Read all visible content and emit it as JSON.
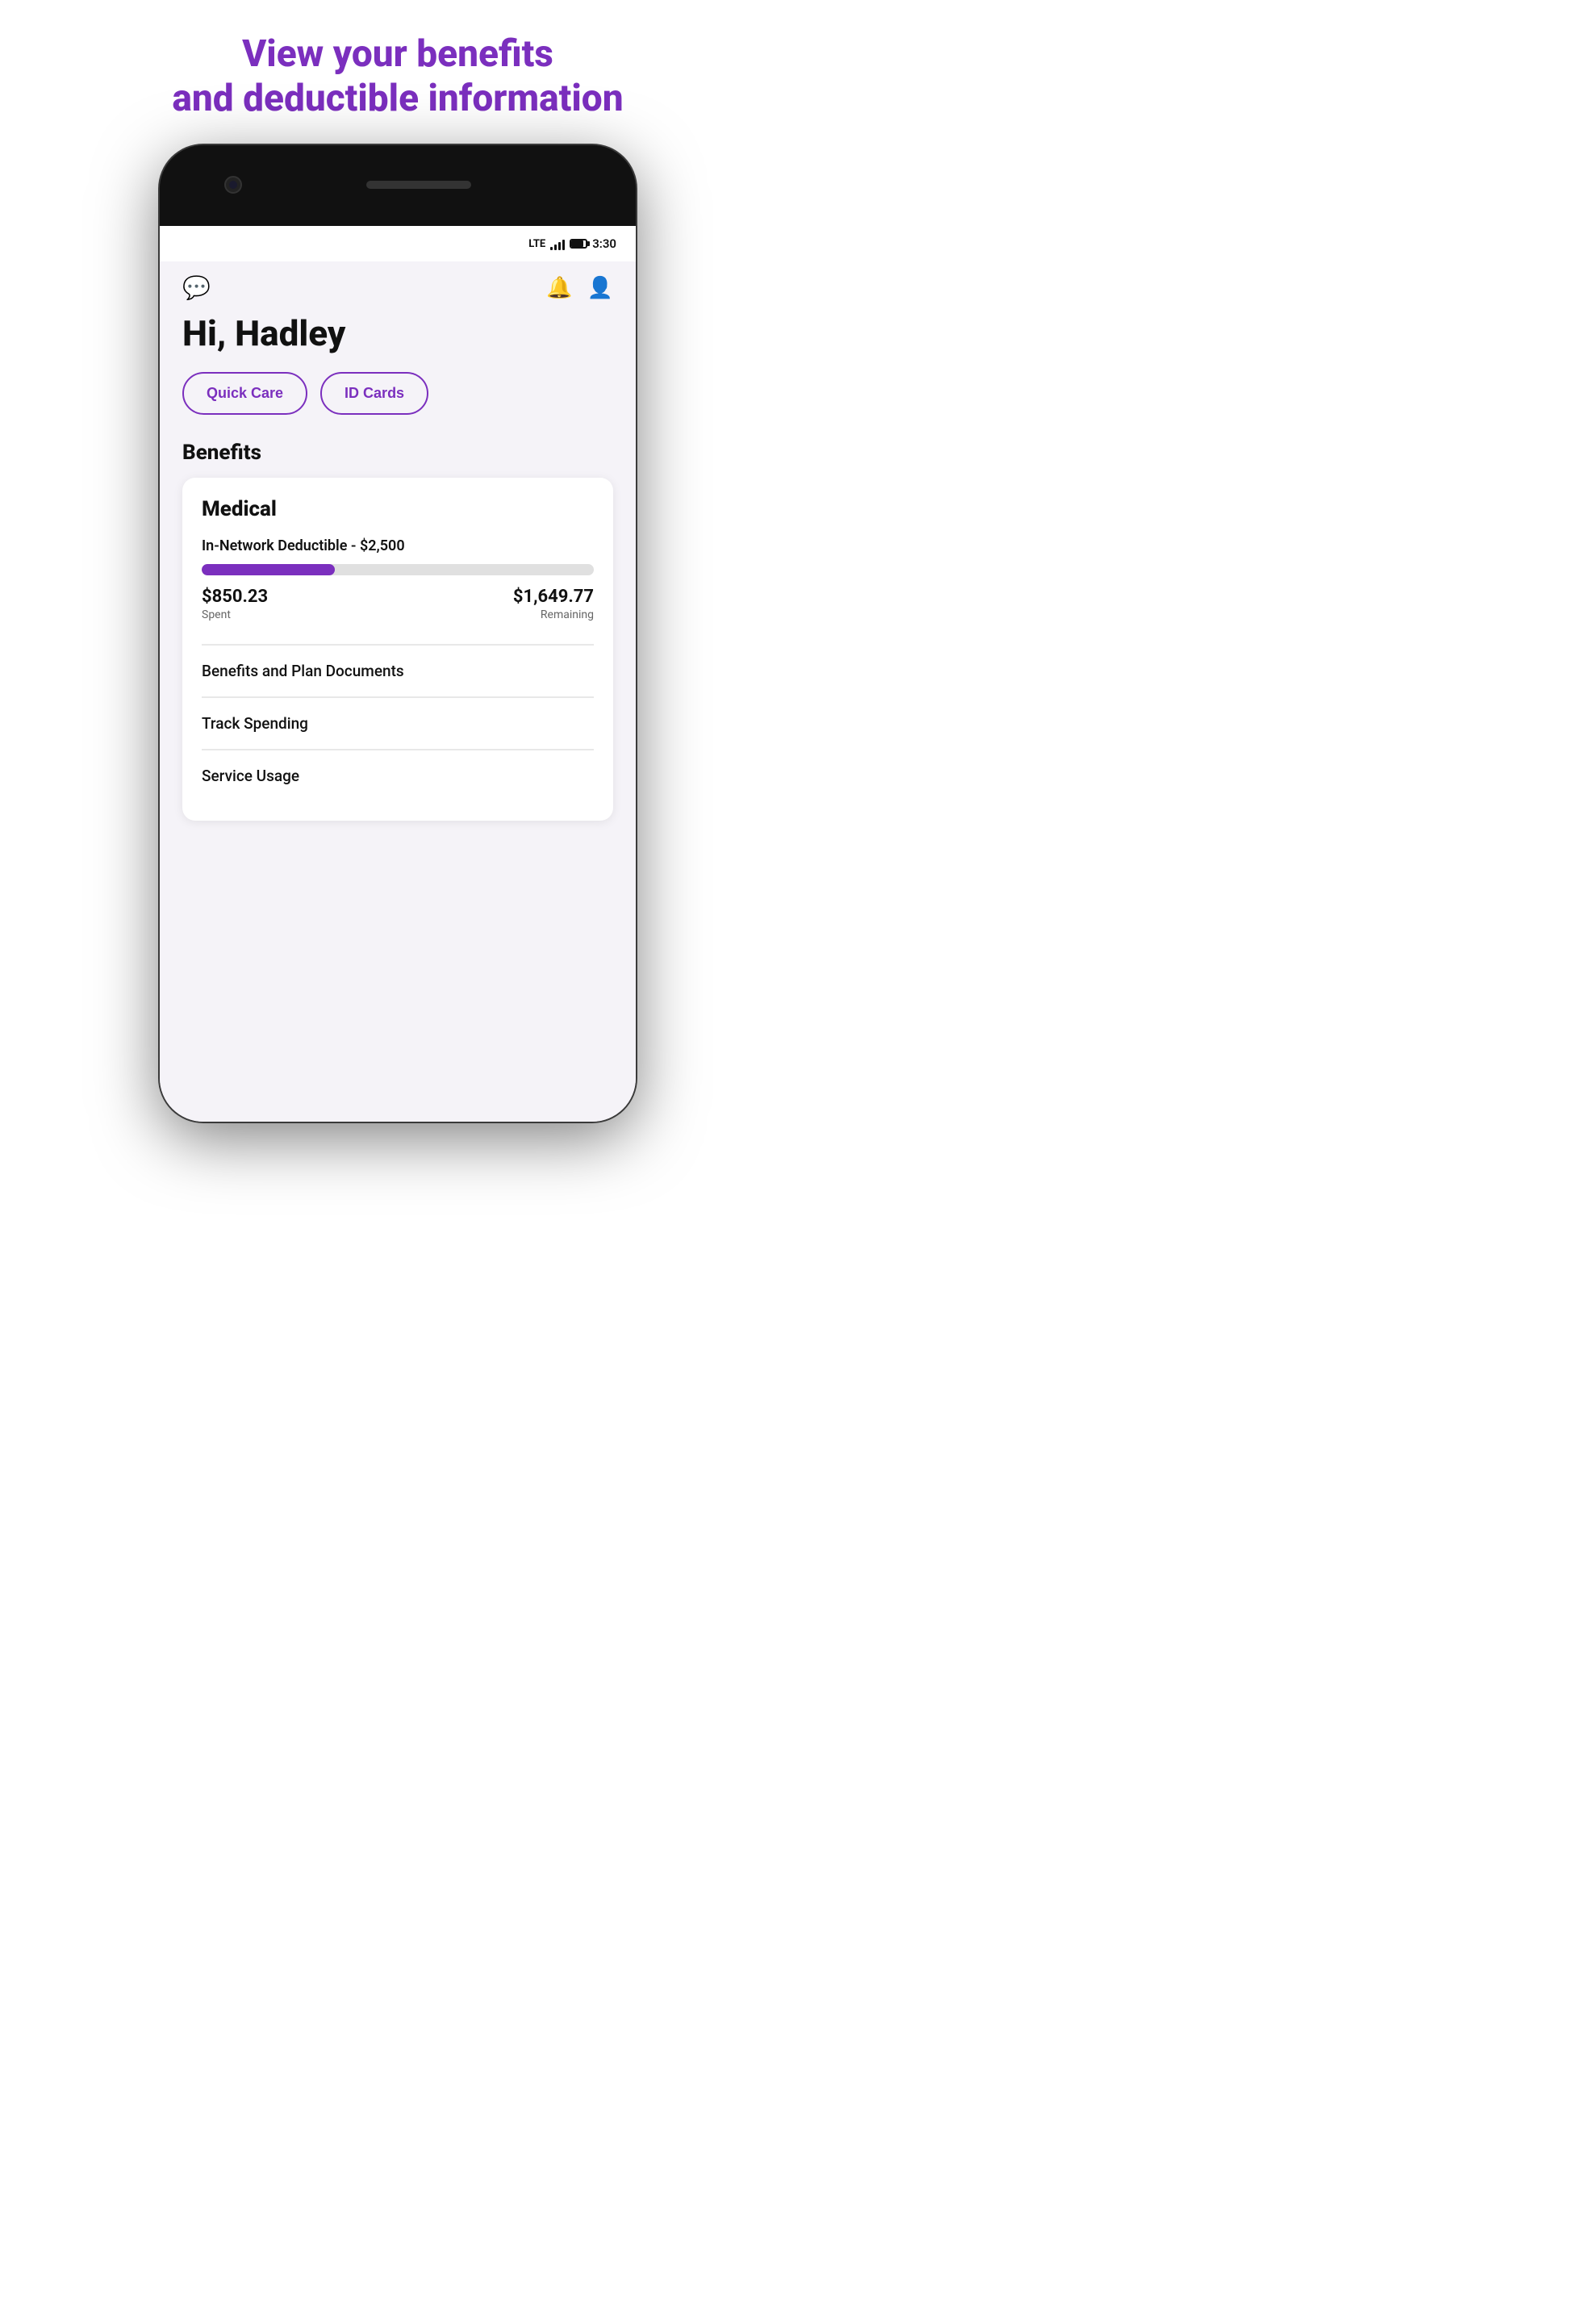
{
  "page": {
    "headline_line1": "View your benefits",
    "headline_line2": "and deductible information"
  },
  "status_bar": {
    "lte": "LTE",
    "time": "3:30"
  },
  "header": {
    "greeting": "Hi, Hadley"
  },
  "quick_actions": {
    "quick_care": "Quick Care",
    "id_cards": "ID Cards"
  },
  "benefits": {
    "section_title": "Benefits",
    "card_title": "Medical",
    "deductible_label": "In-Network Deductible - $2,500",
    "progress_percent": 34,
    "spent_value": "$850.23",
    "spent_label": "Spent",
    "remaining_value": "$1,649.77",
    "remaining_label": "Remaining",
    "link1": "Benefits and Plan Documents",
    "link2": "Track Spending",
    "link3": "Service Usage"
  }
}
